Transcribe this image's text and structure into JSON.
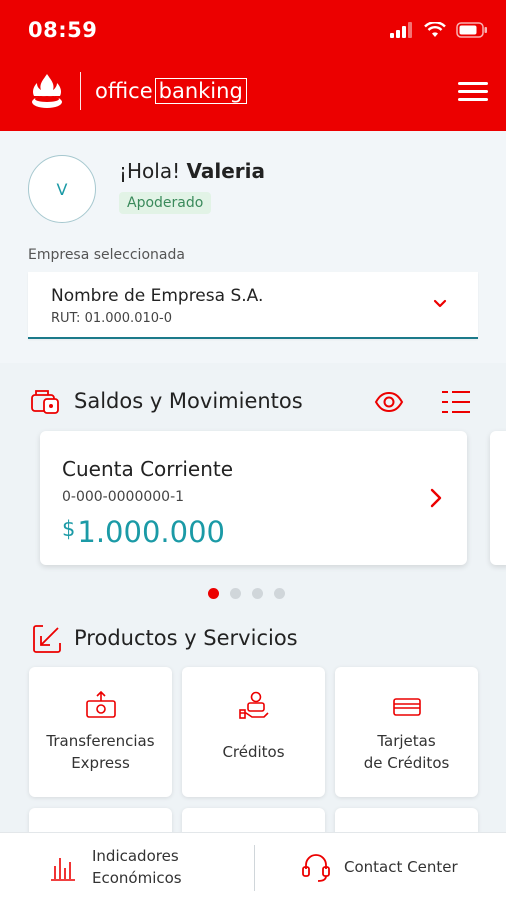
{
  "status_bar": {
    "time": "08:59"
  },
  "header": {
    "brand_prefix": "office",
    "brand_boxed": "banking"
  },
  "profile": {
    "avatar_initial": "V",
    "greeting_prefix": "¡Hola!",
    "user_name": "Valeria",
    "role": "Apoderado",
    "company_label": "Empresa seleccionada",
    "company_name": "Nombre de Empresa S.A.",
    "company_rut": "RUT: 01.000.010-0"
  },
  "balances": {
    "title": "Saldos y Movimientos",
    "account": {
      "title": "Cuenta Corriente",
      "number": "0-000-0000000-1",
      "currency": "$",
      "amount": "1.000.000"
    },
    "pages_total": 4,
    "page_active": 1
  },
  "products": {
    "title": "Productos y Servicios",
    "items": [
      {
        "label": "Transferencias\nExpress",
        "icon": "transfer-icon"
      },
      {
        "label": "Créditos",
        "icon": "credit-hand-icon"
      },
      {
        "label": "Tarjetas\nde Créditos",
        "icon": "credit-card-icon"
      }
    ]
  },
  "bottom_bar": {
    "indicators": "Indicadores\nEconómicos",
    "contact": "Contact Center"
  },
  "colors": {
    "brand_red": "#ec0000",
    "teal": "#1b9aa6"
  }
}
